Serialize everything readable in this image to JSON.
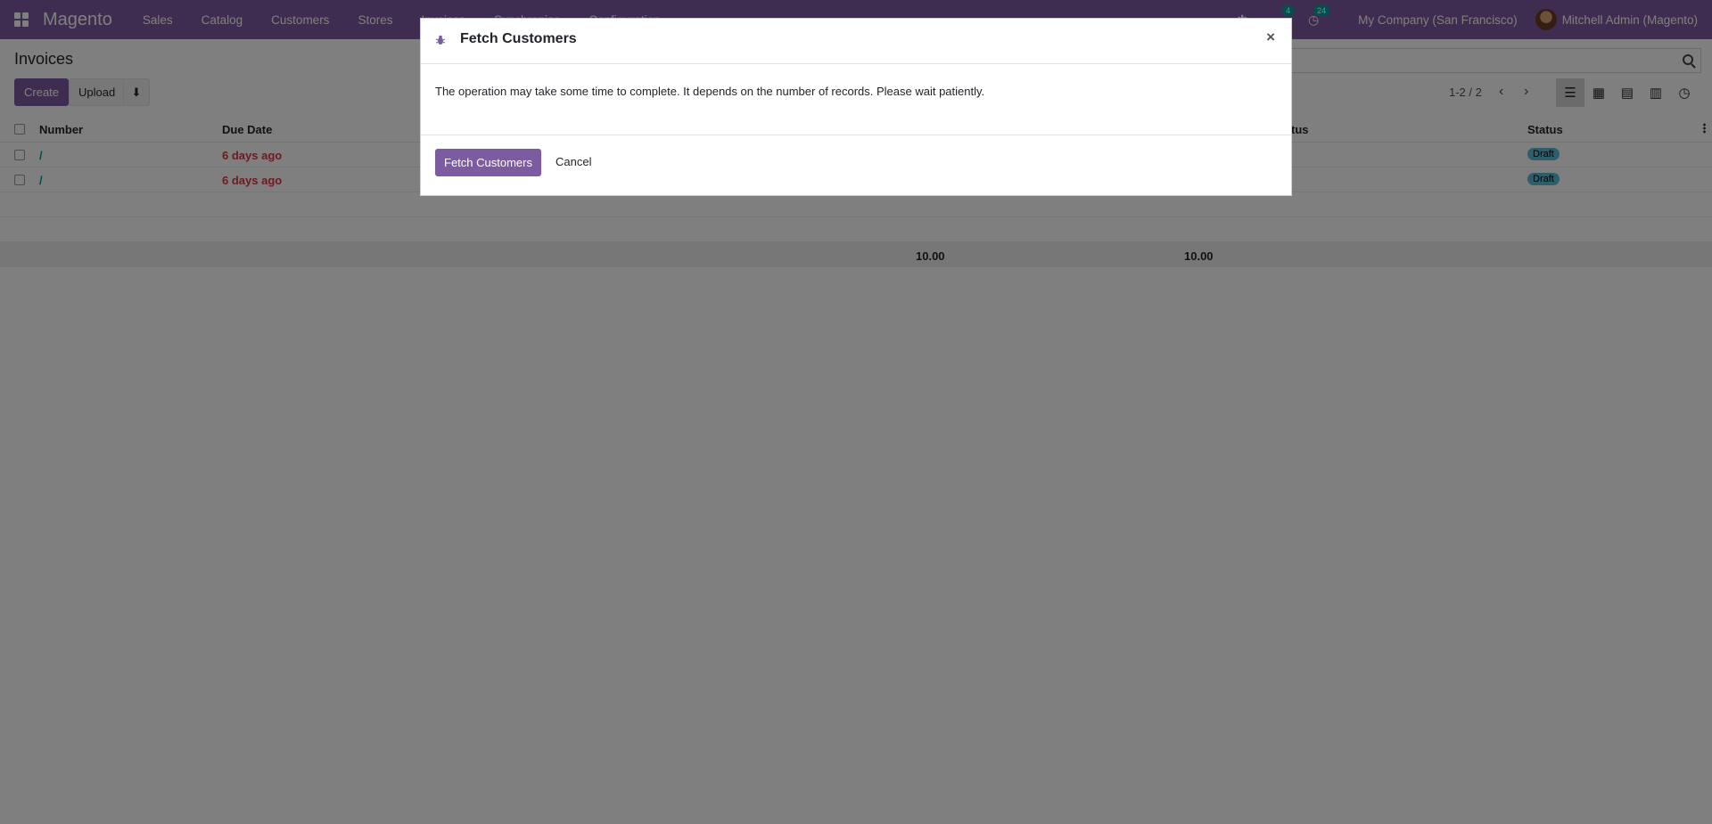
{
  "navbar": {
    "brand": "Magento",
    "menu": [
      "Sales",
      "Catalog",
      "Customers",
      "Stores",
      "Invoices",
      "Synchronise",
      "Configuration"
    ],
    "chat_count": "4",
    "activity_count": "24",
    "company": "My Company (San Francisco)",
    "user": "Mitchell Admin (Magento)"
  },
  "control": {
    "breadcrumb": "Invoices",
    "create_label": "Create",
    "upload_label": "Upload",
    "pager": "1-2 / 2"
  },
  "list": {
    "columns": {
      "number": "Number",
      "due_date": "Due Date",
      "status_partial": "tus",
      "status": "Status"
    },
    "rows": [
      {
        "number": "/",
        "due_date": "6 days ago",
        "status": "Draft"
      },
      {
        "number": "/",
        "due_date": "6 days ago",
        "status": "Draft"
      }
    ],
    "totals": {
      "col1": "10.00",
      "col2": "10.00"
    }
  },
  "modal": {
    "title": "Fetch Customers",
    "close": "×",
    "message": "The operation may take some time to complete. It depends on the number of records. Please wait patiently.",
    "confirm_label": "Fetch Customers",
    "cancel_label": "Cancel"
  },
  "colors": {
    "brand": "#7c5ba0",
    "accent": "#00a09d",
    "overdue": "#dc3545"
  }
}
